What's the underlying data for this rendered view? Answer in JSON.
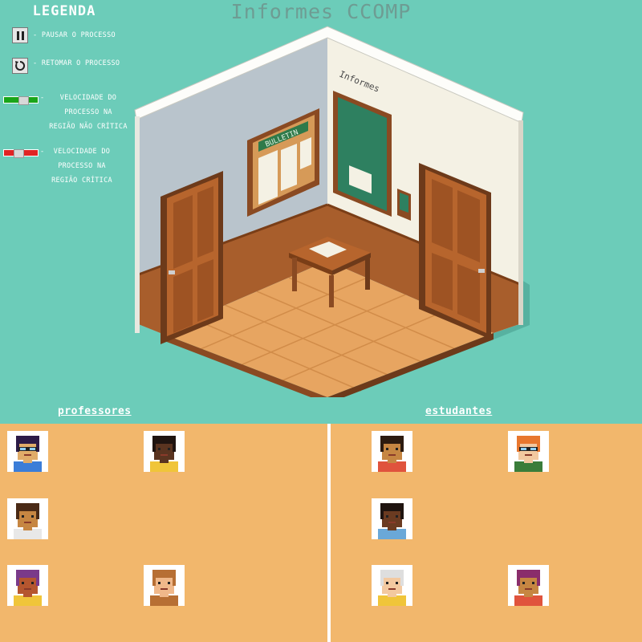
{
  "title": "Informes CCOMP",
  "legend": {
    "title": "LEGENDA",
    "pause_label": "- PAUSAR O PROCESSO",
    "resume_label": "- RETOMAR O PROCESSO",
    "speed_normal": [
      "VELOCIDADE DO",
      "PROCESSO NA",
      "REGIÃO NÃO CRÍTICA"
    ],
    "speed_critical": [
      "VELOCIDADE DO",
      "PROCESSO NA",
      "REGIÃO CRÍTICA"
    ],
    "slider_colors": {
      "normal": "#19a519",
      "critical": "#e02424"
    }
  },
  "room": {
    "board_label": "Informes",
    "bulletin_label": "BULLETIN"
  },
  "sections": {
    "professores_label": "professores",
    "estudantes_label": "estudantes"
  },
  "professores": [
    {
      "id": "prof-1",
      "skin": "#e0ac69",
      "hair": "#2c1b47",
      "shirt": "#3b7dd8",
      "glasses": true
    },
    {
      "id": "prof-2",
      "skin": "#5a3420",
      "hair": "#1f1410",
      "shirt": "#f0c53a",
      "glasses": false
    },
    {
      "id": "prof-3",
      "skin": "#c68642",
      "hair": "#4a2a16",
      "shirt": "#e8e8e8",
      "glasses": false
    },
    {
      "id": "prof-4",
      "skin": "#b5562f",
      "hair": "#7a3a8a",
      "shirt": "#f0c53a",
      "glasses": false
    },
    {
      "id": "prof-5",
      "skin": "#f0b88a",
      "hair": "#b76f34",
      "shirt": "#b76f34",
      "glasses": false
    }
  ],
  "estudantes": [
    {
      "id": "est-1",
      "skin": "#c68642",
      "hair": "#2c1b10",
      "shirt": "#e0533d",
      "glasses": false
    },
    {
      "id": "est-2",
      "skin": "#f3c9a0",
      "hair": "#e8772e",
      "shirt": "#3a7d3a",
      "glasses": true
    },
    {
      "id": "est-3",
      "skin": "#6b3b21",
      "hair": "#1f1410",
      "shirt": "#6aa8d8",
      "glasses": false
    },
    {
      "id": "est-4",
      "skin": "#f3c9a0",
      "hair": "#dedede",
      "shirt": "#f0c53a",
      "glasses": false
    },
    {
      "id": "est-5",
      "skin": "#c68642",
      "hair": "#8a2d6b",
      "shirt": "#e0533d",
      "glasses": false
    }
  ]
}
